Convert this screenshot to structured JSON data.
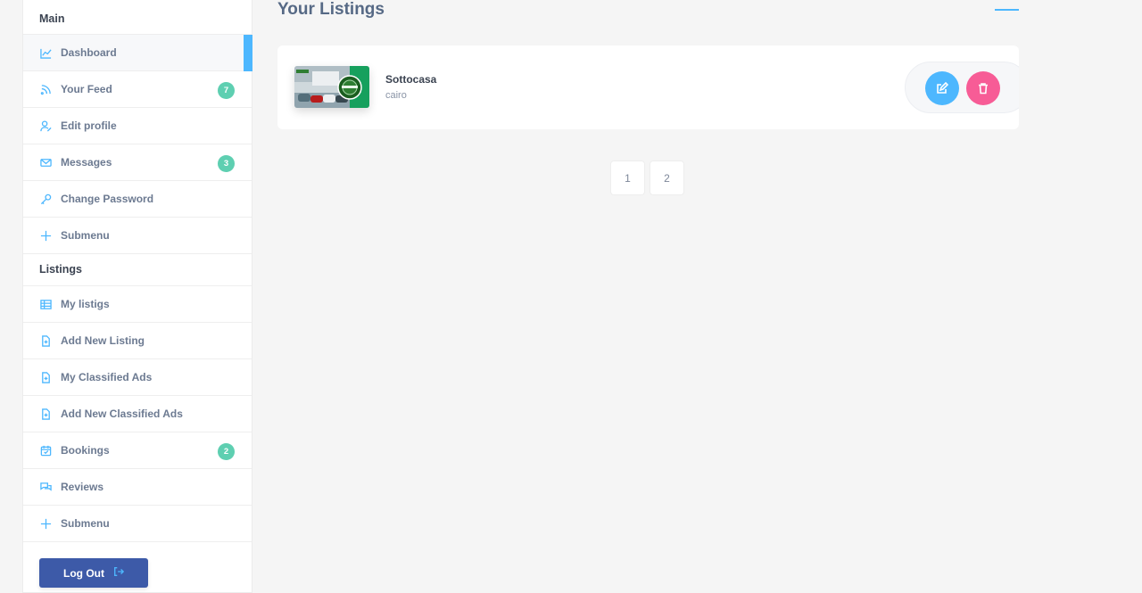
{
  "sidebar": {
    "main_title": "Main",
    "main_items": [
      {
        "label": "Dashboard",
        "icon": "chart-icon",
        "active": true
      },
      {
        "label": "Your Feed",
        "icon": "rss-icon",
        "badge": "7"
      },
      {
        "label": "Edit profile",
        "icon": "user-edit-icon"
      },
      {
        "label": "Messages",
        "icon": "envelope-icon",
        "badge": "3"
      },
      {
        "label": "Change Password",
        "icon": "key-icon"
      },
      {
        "label": "Submenu",
        "icon": "plus-icon"
      }
    ],
    "listings_title": "Listings",
    "listing_items": [
      {
        "label": "My listigs",
        "icon": "table-icon"
      },
      {
        "label": "Add New Listing",
        "icon": "file-plus-icon"
      },
      {
        "label": "My Classified Ads",
        "icon": "file-plus-icon"
      },
      {
        "label": "Add New Classified Ads",
        "icon": "file-plus-icon"
      },
      {
        "label": "Bookings",
        "icon": "calendar-icon",
        "badge": "2"
      },
      {
        "label": "Reviews",
        "icon": "comments-icon"
      },
      {
        "label": "Submenu",
        "icon": "plus-icon"
      }
    ],
    "logout_label": "Log Out"
  },
  "main": {
    "title": "Your Listings",
    "listing": {
      "name": "Sottocasa",
      "city": "cairo"
    },
    "pagination": [
      "1",
      "2"
    ]
  },
  "colors": {
    "accent": "#4db7fe",
    "badge": "#5ecfb1",
    "delete": "#f75c96",
    "logout": "#3d5aa8"
  }
}
